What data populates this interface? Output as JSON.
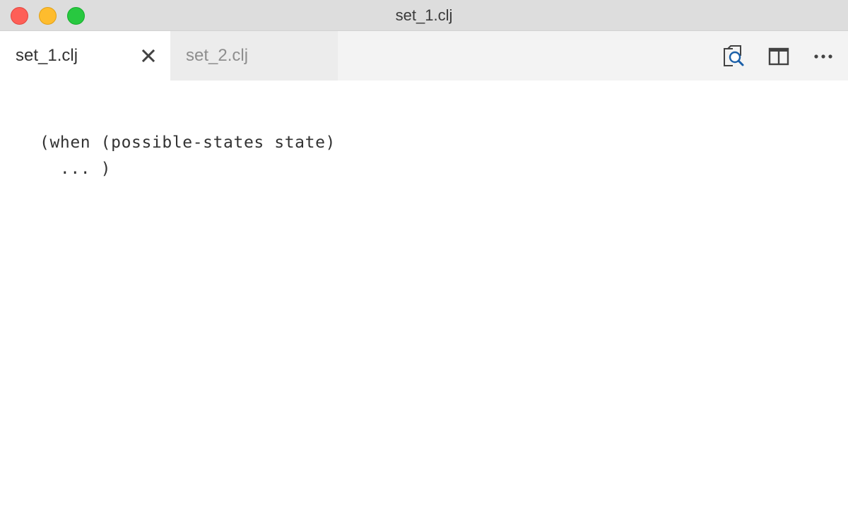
{
  "window": {
    "title": "set_1.clj",
    "controls": [
      "close",
      "minimize",
      "maximize"
    ]
  },
  "tabs": [
    {
      "label": "set_1.clj",
      "active": true,
      "close_icon": "close-icon"
    },
    {
      "label": "set_2.clj",
      "active": false
    }
  ],
  "editor_actions": [
    {
      "name": "open-preview",
      "icon": "search-preview-icon"
    },
    {
      "name": "split-editor",
      "icon": "split-editor-icon"
    },
    {
      "name": "more-actions",
      "icon": "ellipsis-icon"
    }
  ],
  "editor": {
    "lines": [
      "(when (possible-states state)",
      "  ... )"
    ]
  },
  "colors": {
    "titlebar": "#dddddd",
    "tabbar": "#f3f3f3",
    "active_tab": "#ffffff",
    "inactive_tab": "#ececec",
    "accent_blue": "#1a5fa8"
  }
}
